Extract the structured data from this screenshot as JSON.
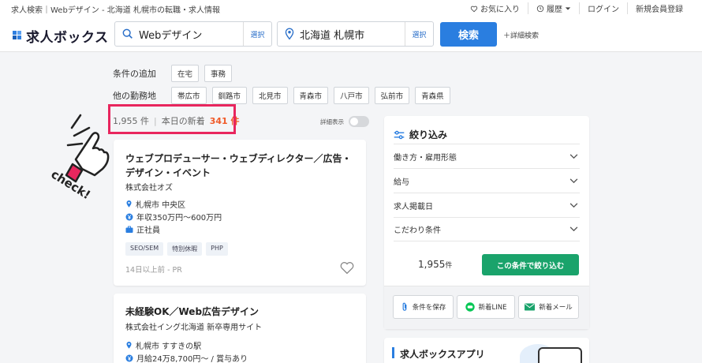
{
  "topbar": {
    "tagline": "求人検索｜Webデザイン - 北海道 札幌市の転職・求人情報",
    "favorites": "お気に入り",
    "history": "履歴",
    "login": "ログイン",
    "register": "新規会員登録"
  },
  "header": {
    "logo": "求人ボックス",
    "keyword_value": "Webデザイン",
    "keyword_select": "選択",
    "location_value": "北海道 札幌市",
    "location_select": "選択",
    "search_button": "検索",
    "advanced": "＋詳細検索"
  },
  "filters": {
    "add_label": "条件の追加",
    "add_chips": [
      "在宅",
      "事務"
    ],
    "area_label": "他の勤務地",
    "area_chips": [
      "帯広市",
      "釧路市",
      "北見市",
      "青森市",
      "八戸市",
      "弘前市",
      "青森県"
    ]
  },
  "results": {
    "total": "1,955 件",
    "new_label": "本日の新着",
    "new_count": "341 件",
    "detail_toggle": "詳細表示"
  },
  "jobs": [
    {
      "title_line1": "ウェブプロデューサー・ウェブディレクター／広告・",
      "title_line2": "デザイン・イベント",
      "company": "株式会社オズ",
      "location": "札幌市 中央区",
      "salary": "年収350万円〜600万円",
      "employment": "正社員",
      "tags": [
        "SEO/SEM",
        "特別休暇",
        "PHP"
      ],
      "posted": "14日以上前 - PR"
    },
    {
      "title_line1": "未経験OK／Web広告デザイン",
      "company": "株式会社イング北海道 新卒専用サイト",
      "location": "札幌市 すすきの駅",
      "salary": "月給24万8,700円〜 / 賞与あり"
    }
  ],
  "sidebar": {
    "title": "絞り込み",
    "sections": [
      "働き方・雇用形態",
      "給与",
      "求人掲載日",
      "こだわり条件"
    ],
    "count_number": "1,955",
    "count_unit": "件",
    "apply_button": "この条件で絞り込む",
    "save_button": "条件を保存",
    "line_button": "新着LINE",
    "mail_button": "新着メール",
    "app_title": "求人ボックスアプリ"
  },
  "annotation": {
    "check_text": "check!"
  },
  "colors": {
    "primary_blue": "#2a7ee0",
    "apply_green": "#1aa36b",
    "new_orange": "#f05a28",
    "highlight_pink": "#e8265e"
  }
}
